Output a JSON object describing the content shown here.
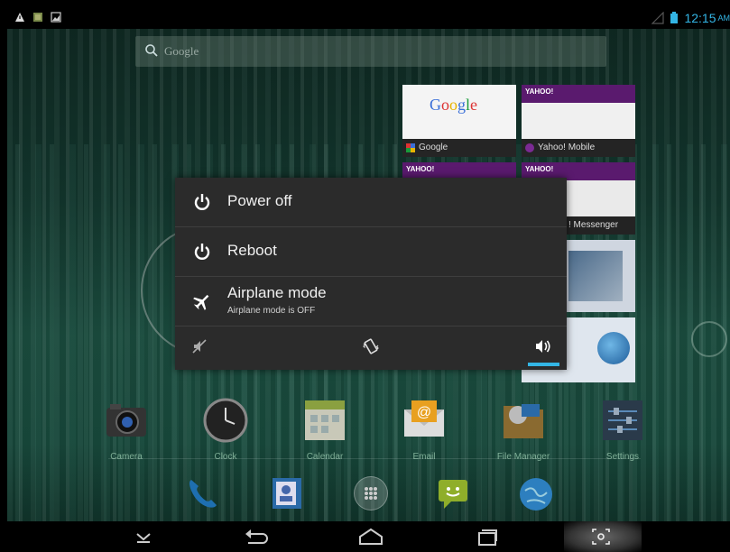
{
  "status_bar": {
    "time": "12:15",
    "ampm": "AM",
    "left_icons": [
      "warning-icon",
      "sd-card-icon",
      "image-icon"
    ],
    "right_icons": [
      "signal-icon",
      "battery-icon"
    ]
  },
  "search": {
    "placeholder": "Google"
  },
  "recents": [
    {
      "label": "Google",
      "logo": "Google"
    },
    {
      "label": "Yahoo! Mobile",
      "logo": "YAHOO!"
    },
    {
      "label": "! Messenger",
      "logo": "YAHOO!"
    },
    {
      "label": "",
      "logo": "YAHOO!"
    }
  ],
  "power_dialog": {
    "items": [
      {
        "label": "Power off",
        "icon": "power-icon"
      },
      {
        "label": "Reboot",
        "icon": "power-icon"
      },
      {
        "label": "Airplane mode",
        "sub": "Airplane mode is OFF",
        "icon": "airplane-icon"
      }
    ],
    "sound_modes": [
      "silent-icon",
      "vibrate-icon",
      "sound-on-icon"
    ],
    "selected_mode": "sound-on-icon"
  },
  "apps": [
    {
      "label": "Camera"
    },
    {
      "label": "Clock"
    },
    {
      "label": "Calendar"
    },
    {
      "label": "Email"
    },
    {
      "label": "File Manager"
    },
    {
      "label": "Settings"
    }
  ],
  "dock": [
    "phone-icon",
    "contacts-icon",
    "all-apps-icon",
    "messaging-icon",
    "browser-icon"
  ],
  "nav": [
    "hide-keyboard-icon",
    "back-icon",
    "home-icon",
    "recents-icon",
    "screenshot-icon"
  ],
  "colors": {
    "accent": "#33b5e5",
    "dialog_bg": "#2b2b2b"
  }
}
